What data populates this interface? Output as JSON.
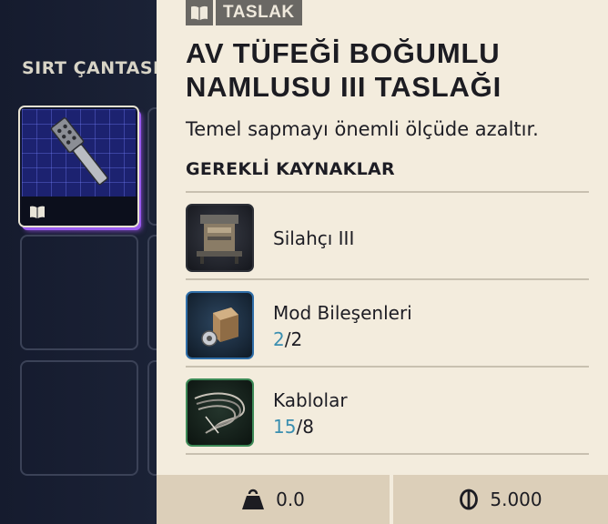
{
  "inventory": {
    "title": "SIRT ÇANTASI",
    "selected_slot_icon": "blueprint-book-icon"
  },
  "tooltip": {
    "badge": {
      "icon": "book-icon",
      "label": "TASLAK"
    },
    "title": "AV TÜFEĞİ BOĞUMLU NAMLUSU III TASLAĞI",
    "description": "Temel sapmayı önemli ölçüde azaltır.",
    "requirements_header": "GEREKLİ KAYNAKLAR",
    "requirements": [
      {
        "name": "Silahçı III",
        "icon": "workbench-icon"
      },
      {
        "name": "Mod Bileşenleri",
        "have": "2",
        "need": "/2",
        "icon": "mod-components-icon"
      },
      {
        "name": "Kablolar",
        "have": "15",
        "need": "/8",
        "icon": "wires-icon"
      }
    ],
    "stats": {
      "weight_icon": "weight-icon",
      "weight": "0.0",
      "price_icon": "coin-icon",
      "price": "5.000"
    }
  },
  "colors": {
    "panel_bg": "#f3ecdd",
    "footer_bg": "#dccfb9",
    "have_count": "#3b8fb0",
    "rarity_purple": "#9a5cf0",
    "badge_bg": "#6a6864"
  }
}
